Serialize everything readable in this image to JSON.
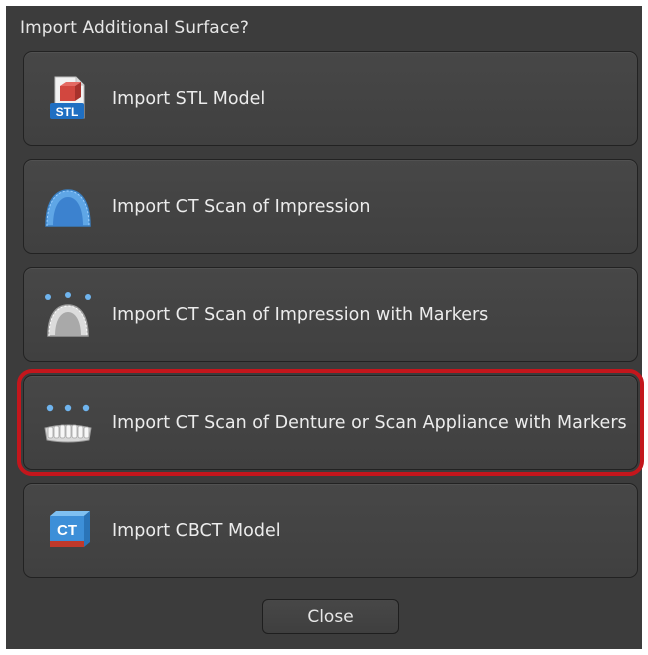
{
  "dialog": {
    "title": "Import Additional Surface?",
    "options": [
      {
        "label": "Import STL Model",
        "icon": "stl-file-icon"
      },
      {
        "label": "Import CT Scan of Impression",
        "icon": "impression-icon"
      },
      {
        "label": "Import CT Scan of Impression with Markers",
        "icon": "impression-markers-icon"
      },
      {
        "label": "Import CT Scan of Denture or Scan Appliance with Markers",
        "icon": "denture-markers-icon",
        "selected": true
      },
      {
        "label": "Import CBCT Model",
        "icon": "cbct-icon"
      }
    ],
    "close_label": "Close",
    "stl_badge": "STL",
    "ct_badge": "CT"
  },
  "colors": {
    "background": "#3c3c3c",
    "button": "#444444",
    "selection_outline": "#c4161c",
    "text": "#ececec"
  }
}
